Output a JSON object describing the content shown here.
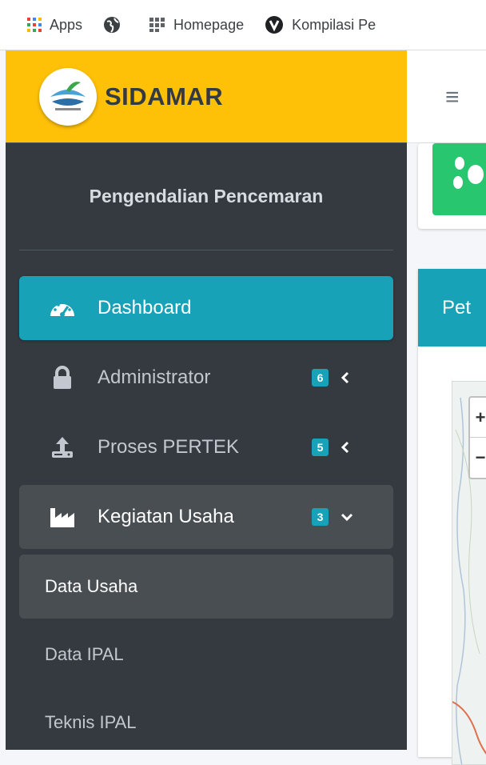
{
  "bookmarks": [
    {
      "label": "Apps",
      "icon": "apps-grid-icon"
    },
    {
      "label": "",
      "icon": "globe-icon"
    },
    {
      "label": "Homepage",
      "icon": "homepage-grid-icon"
    },
    {
      "label": "Kompilasi Pe",
      "icon": "v-logo-icon"
    }
  ],
  "brand": {
    "title": "SIDAMAR",
    "logo": "sidamar-logo"
  },
  "user_panel": {
    "name": "Pengendalian Pencemaran"
  },
  "nav": [
    {
      "label": "Dashboard",
      "icon": "dashboard-gauge-icon",
      "active": true
    },
    {
      "label": "Administrator",
      "icon": "lock-icon",
      "badge": "6",
      "chevron": "chevron-left-icon"
    },
    {
      "label": "Proses PERTEK",
      "icon": "upload-icon",
      "badge": "5",
      "chevron": "chevron-left-icon"
    },
    {
      "label": "Kegiatan Usaha",
      "icon": "industry-icon",
      "badge": "3",
      "chevron": "chevron-down-icon",
      "open": true
    }
  ],
  "submenu": [
    {
      "label": "Data Usaha",
      "active": true
    },
    {
      "label": "Data IPAL"
    },
    {
      "label": "Teknis IPAL"
    }
  ],
  "topbar": {
    "menu_icon": "hamburger-icon",
    "menu_glyph": "≡"
  },
  "content": {
    "card_title": "Pet",
    "map_zoom_in": "+",
    "map_zoom_out": "−"
  },
  "colors": {
    "brand_bg": "#ffc107",
    "sidebar_bg": "#343a40",
    "accent": "#17a2b8",
    "infobox_green": "#28c76f"
  }
}
